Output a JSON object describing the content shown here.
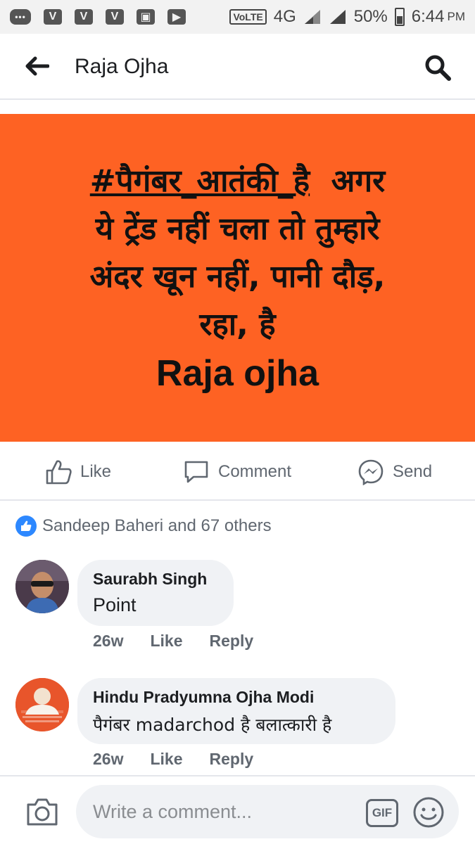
{
  "status_bar": {
    "network": "VoLTE",
    "network_type": "4G",
    "battery": "50%",
    "time": "6:44",
    "ampm": "PM",
    "icons": [
      "messages-icon",
      "v-app-icon",
      "v-app-icon",
      "v-app-icon",
      "gallery-icon",
      "youtube-icon"
    ]
  },
  "header": {
    "title": "Raja Ojha"
  },
  "post": {
    "hashtag": "#पैगंबर_आतंकी_है",
    "line1_rest": "  अगर",
    "line2": "ये ट्रेंड नहीं चला तो तुम्हारे",
    "line3": "अंदर खून नहीं, पानी दौड़,",
    "line4": "रहा, है",
    "author": "Raja ojha",
    "background_color": "#fe6223"
  },
  "actions": {
    "like": "Like",
    "comment": "Comment",
    "send": "Send"
  },
  "reactions": {
    "summary": "Sandeep Baheri and 67 others"
  },
  "comments": [
    {
      "name": "Saurabh Singh",
      "text": "Point",
      "time": "26w",
      "like": "Like",
      "reply": "Reply"
    },
    {
      "name": "Hindu Pradyumna Ojha Modi",
      "text": "पैगंबर madarchod है बलात्कारी है",
      "time": "26w",
      "like": "Like",
      "reply": "Reply"
    }
  ],
  "composer": {
    "placeholder": "Write a comment...",
    "gif": "GIF"
  }
}
